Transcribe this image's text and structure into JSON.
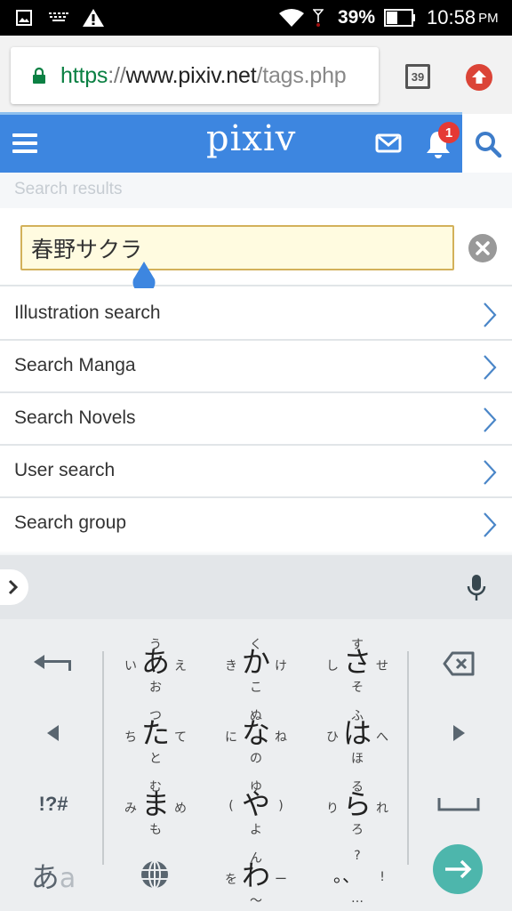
{
  "status_bar": {
    "notifications": [
      "image-icon",
      "keyboard-icon",
      "warning-icon"
    ],
    "battery_percent": "39%",
    "time": "10:58",
    "ampm": "PM"
  },
  "browser": {
    "url_scheme": "https",
    "url_separator": "://",
    "url_host": "www.pixiv.net",
    "url_path": "/tags.php",
    "tab_count": "39"
  },
  "header": {
    "logo": "pixiv",
    "notification_count": "1"
  },
  "search": {
    "section_label": "Search results",
    "query": "春野サクラ"
  },
  "search_options": [
    {
      "label": "Illustration search"
    },
    {
      "label": "Search Manga"
    },
    {
      "label": "Search Novels"
    },
    {
      "label": "User search"
    },
    {
      "label": "Search group"
    }
  ],
  "keyboard": {
    "kana_keys": [
      {
        "main": "あ",
        "up": "う",
        "left": "い",
        "right": "え",
        "down": "お"
      },
      {
        "main": "か",
        "up": "く",
        "left": "き",
        "right": "け",
        "down": "こ"
      },
      {
        "main": "さ",
        "up": "す",
        "left": "し",
        "right": "せ",
        "down": "そ"
      },
      {
        "main": "た",
        "up": "つ",
        "left": "ち",
        "right": "て",
        "down": "と"
      },
      {
        "main": "な",
        "up": "ぬ",
        "left": "に",
        "right": "ね",
        "down": "の"
      },
      {
        "main": "は",
        "up": "ふ",
        "left": "ひ",
        "right": "へ",
        "down": "ほ"
      },
      {
        "main": "ま",
        "up": "む",
        "left": "み",
        "right": "め",
        "down": "も"
      },
      {
        "main": "や",
        "up": "ゆ",
        "left": "(",
        "right": ")",
        "down": "よ"
      },
      {
        "main": "ら",
        "up": "る",
        "left": "り",
        "right": "れ",
        "down": "ろ"
      },
      {
        "main": "わ",
        "up": "ん",
        "left": "を",
        "right": "ー",
        "down": "〜"
      },
      {
        "main": "。、",
        "up": "?",
        "left": "",
        "right": "!",
        "down": "…"
      }
    ],
    "symbols_label": "!?#",
    "mode_kana": "あ",
    "mode_latin": "a"
  },
  "colors": {
    "pixiv_blue": "#3d86e0",
    "chevron_blue": "#4a86c8",
    "input_bg": "#fffbe0",
    "input_border": "#d3b15a",
    "enter_teal": "#4db6ac",
    "badge_red": "#e53935",
    "secure_green": "#0b8043"
  }
}
